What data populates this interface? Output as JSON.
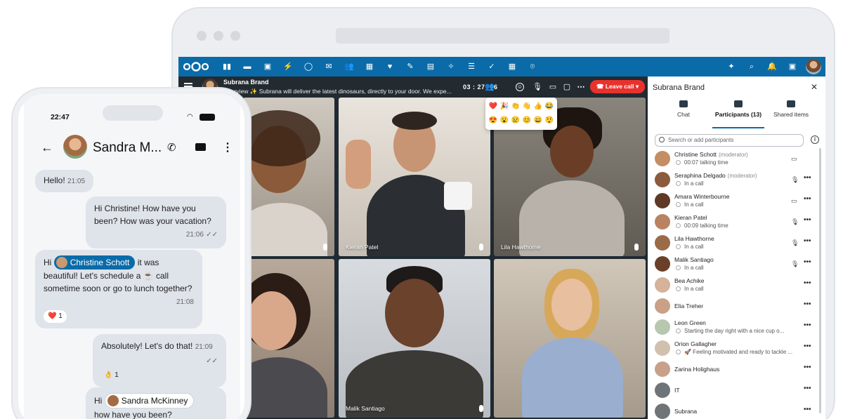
{
  "brand": {
    "accent": "#0a6ba8",
    "danger": "#e9322d"
  },
  "topbar": {
    "apps": [
      "dashboard-icon",
      "files-icon",
      "photos-icon",
      "activity-icon",
      "talk-icon",
      "mail-icon",
      "contacts-icon",
      "calendar-icon",
      "favorites-icon",
      "notes-icon",
      "deck-icon",
      "assistant-icon",
      "tasks-icon",
      "checklist-icon",
      "tables-icon",
      "maps-icon"
    ],
    "right": [
      "ai-icon",
      "search-icon",
      "notifications-icon",
      "contacts-menu-icon"
    ]
  },
  "call": {
    "title": "Subrana Brand",
    "subtitle": "Overview ✨ Subrana will deliver the latest dinosaurs, directly to your door. We expe...",
    "timer": "03 : 27",
    "participants_count": "6",
    "leave_label": "Leave call",
    "emojis": [
      "❤️",
      "🎉",
      "👏",
      "👋",
      "👍",
      "😂",
      "😍",
      "😮",
      "😢",
      "😊",
      "😄",
      "😲"
    ]
  },
  "tiles": [
    {
      "name": "e"
    },
    {
      "name": "Kieran Patel"
    },
    {
      "name": "Lila Hawthorne"
    },
    {
      "name": ""
    },
    {
      "name": "Malik Santiago"
    },
    {
      "name": ""
    }
  ],
  "panel": {
    "title": "Subrana Brand",
    "tabs": [
      {
        "label": "Chat"
      },
      {
        "label": "Participants (13)"
      },
      {
        "label": "Shared items"
      }
    ],
    "search_placeholder": "Search or add participants",
    "participants": [
      {
        "name": "Christine Schott",
        "role": "(moderator)",
        "status": "00:07 talking time",
        "media": "video",
        "more": ""
      },
      {
        "name": "Seraphina Delgado",
        "role": "(moderator)",
        "status": "In a call",
        "media": "mic",
        "more": "•••"
      },
      {
        "name": "Amara Winterbourne",
        "role": "",
        "status": "In a call",
        "media": "video",
        "more": "•••"
      },
      {
        "name": "Kieran Patel",
        "role": "",
        "status": "00:09 talking time",
        "media": "mic",
        "more": "•••"
      },
      {
        "name": "Lila Hawthorne",
        "role": "",
        "status": "In a call",
        "media": "mic",
        "more": "•••"
      },
      {
        "name": "Malik Santiago",
        "role": "",
        "status": "In a call",
        "media": "mic",
        "more": "•••"
      },
      {
        "name": "Bea Achike",
        "role": "",
        "status": "In a call",
        "media": "",
        "more": "•••"
      },
      {
        "name": "Elia Treher",
        "role": "",
        "status": "",
        "media": "",
        "more": "•••"
      },
      {
        "name": "Leon Green",
        "role": "",
        "status": "Starting the day right with a nice cup o...",
        "media": "",
        "more": "•••"
      },
      {
        "name": "Orion Gallagher",
        "role": "",
        "status": "🚀 Feeling motivated and ready to tackle ...",
        "media": "",
        "more": "•••"
      },
      {
        "name": "Zarina Holighaus",
        "role": "",
        "status": "",
        "media": "",
        "more": "•••"
      },
      {
        "name": "IT",
        "role": "",
        "status": "",
        "media": "",
        "more": "•••"
      },
      {
        "name": "Subrana",
        "role": "",
        "status": "",
        "media": "",
        "more": "•••"
      }
    ]
  },
  "phone": {
    "clock": "22:47",
    "contact": "Sandra M...",
    "messages": {
      "m1_text": "Hello!",
      "m1_time": "21:05",
      "m2_text": "Hi Christine! How have you been? How was your vacation?",
      "m2_time": "21:06",
      "m3_pre": "Hi",
      "m3_mention": "Christine Schott",
      "m3_post": "it was",
      "m3_text": "beautiful! Let's schedule a ☕ call sometime soon or go to lunch together?",
      "m3_time": "21:08",
      "m3_reaction": "❤️ 1",
      "m4_text": "Absolutely! Let's do that!",
      "m4_time": "21:09",
      "m4_reaction": "👌 1",
      "m5_pre": "Hi",
      "m5_mention": "Sandra McKinney",
      "m5_text": "how have you been?"
    }
  }
}
